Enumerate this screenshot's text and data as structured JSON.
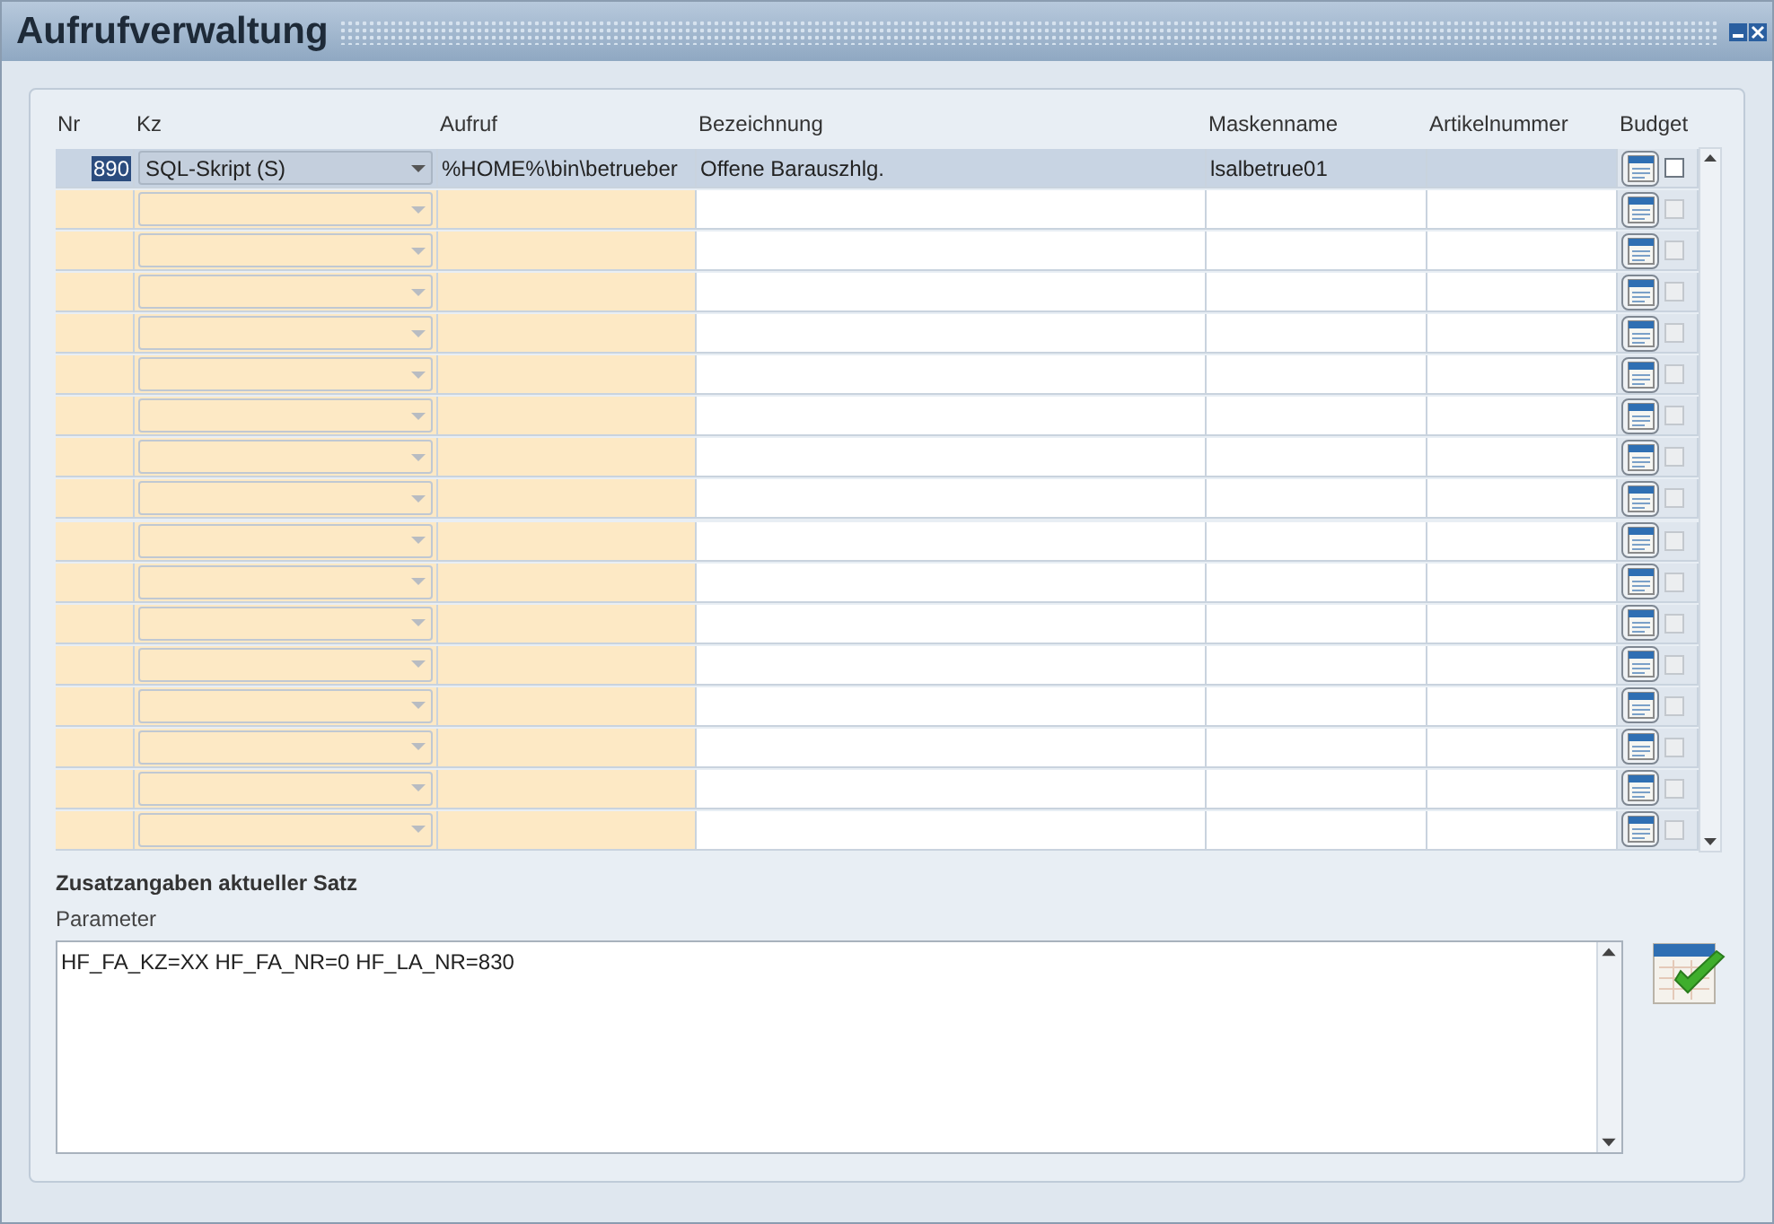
{
  "window": {
    "title": "Aufrufverwaltung"
  },
  "table": {
    "columns": [
      "Nr",
      "Kz",
      "Aufruf",
      "Bezeichnung",
      "Maskenname",
      "Artikelnummer",
      "Budget"
    ],
    "rows": [
      {
        "nr": "890",
        "kz": "SQL-Skript (S)",
        "aufruf": "%HOME%\\bin\\betrueber",
        "bezeichnung": "Offene Barauszhlg.",
        "maskenname": "lsalbetrue01",
        "selected": true,
        "checked": false,
        "disabled": false
      },
      {
        "selected": false,
        "checked": false,
        "disabled": true
      },
      {
        "selected": false,
        "checked": false,
        "disabled": true
      },
      {
        "selected": false,
        "checked": false,
        "disabled": true
      },
      {
        "selected": false,
        "checked": false,
        "disabled": true
      },
      {
        "selected": false,
        "checked": false,
        "disabled": true
      },
      {
        "selected": false,
        "checked": false,
        "disabled": true
      },
      {
        "selected": false,
        "checked": false,
        "disabled": true
      },
      {
        "selected": false,
        "checked": false,
        "disabled": true
      },
      {
        "selected": false,
        "checked": false,
        "disabled": true
      },
      {
        "selected": false,
        "checked": false,
        "disabled": true
      },
      {
        "selected": false,
        "checked": false,
        "disabled": true
      },
      {
        "selected": false,
        "checked": false,
        "disabled": true
      },
      {
        "selected": false,
        "checked": false,
        "disabled": true
      },
      {
        "selected": false,
        "checked": false,
        "disabled": true
      },
      {
        "selected": false,
        "checked": false,
        "disabled": true
      },
      {
        "selected": false,
        "checked": false,
        "disabled": true
      }
    ]
  },
  "details": {
    "heading": "Zusatzangaben aktueller Satz",
    "label": "Parameter",
    "value": "HF_FA_KZ=XX HF_FA_NR=0 HF_LA_NR=830"
  }
}
